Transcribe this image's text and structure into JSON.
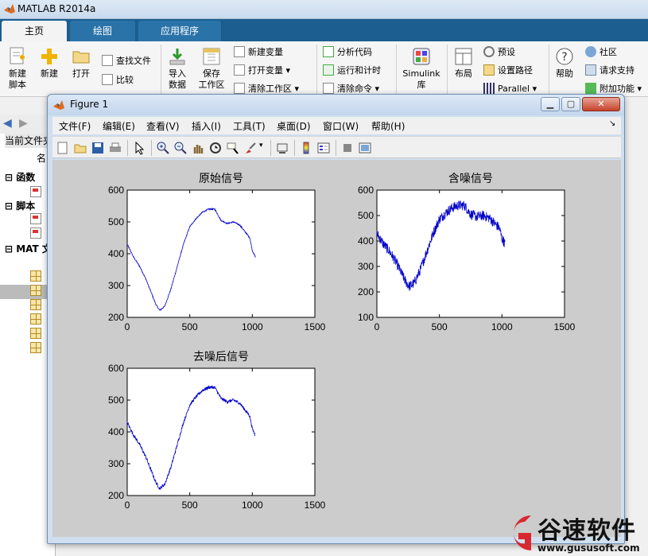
{
  "app": {
    "title": "MATLAB R2014a"
  },
  "ribbon": {
    "tabs": [
      "主页",
      "绘图",
      "应用程序"
    ],
    "active_tab": 0,
    "buttons": {
      "new_script": [
        "新建",
        "脚本"
      ],
      "new": "新建",
      "open": "打开",
      "find_files": "查找文件",
      "compare": "比较",
      "import": [
        "导入",
        "数据"
      ],
      "save_workspace": [
        "保存",
        "工作区"
      ],
      "new_variable": "新建变量",
      "open_variable": "打开变量",
      "clear_workspace": "清除工作区",
      "analyze_code": "分析代码",
      "run_and_time": "运行和计时",
      "clear_commands": "清除命令",
      "simulink": [
        "Simulink",
        "库"
      ],
      "layout": "布局",
      "preferences": "预设",
      "set_path": "设置路径",
      "parallel": "Parallel",
      "help": "帮助",
      "community": "社区",
      "request_support": "请求支持",
      "addons": "附加功能"
    }
  },
  "left_panel": {
    "current_folder": "当前文件夹",
    "name_col": "名",
    "sections": [
      "函数",
      "脚本",
      "MAT 文"
    ]
  },
  "figure": {
    "title": "Figure 1",
    "menus": [
      "文件(F)",
      "编辑(E)",
      "查看(V)",
      "插入(I)",
      "工具(T)",
      "桌面(D)",
      "窗口(W)",
      "帮助(H)"
    ],
    "toolbar_icons": [
      "new-figure-icon",
      "open-file-icon",
      "save-icon",
      "print-icon",
      "pointer-icon",
      "zoom-in-icon",
      "zoom-out-icon",
      "pan-icon",
      "rotate-icon",
      "data-cursor-icon",
      "brush-icon",
      "link-icon",
      "colorbar-icon",
      "legend-icon",
      "hide-plot-tools-icon",
      "show-plot-tools-icon"
    ],
    "line_color": "#0000c8",
    "background": "#cccccc"
  },
  "chart_data": [
    {
      "type": "line",
      "title": "原始信号",
      "xlim": [
        0,
        1500
      ],
      "ylim": [
        200,
        600
      ],
      "xticks": [
        "0",
        "500",
        "1000",
        "1500"
      ],
      "yticks": [
        "200",
        "300",
        "400",
        "500",
        "600"
      ],
      "x": [
        0,
        50,
        100,
        150,
        200,
        230,
        260,
        300,
        350,
        400,
        450,
        500,
        550,
        600,
        650,
        700,
        750,
        800,
        850,
        900,
        950,
        980,
        1000,
        1024
      ],
      "y": [
        430,
        390,
        360,
        320,
        270,
        240,
        222,
        235,
        290,
        360,
        430,
        485,
        510,
        530,
        540,
        540,
        505,
        495,
        500,
        490,
        465,
        450,
        410,
        390
      ]
    },
    {
      "type": "line",
      "title": "含噪信号",
      "xlim": [
        0,
        1500
      ],
      "ylim": [
        100,
        600
      ],
      "xticks": [
        "0",
        "500",
        "1000",
        "1500"
      ],
      "yticks": [
        "100",
        "200",
        "300",
        "400",
        "500",
        "600"
      ],
      "x": [
        0,
        50,
        100,
        150,
        200,
        230,
        260,
        300,
        350,
        400,
        450,
        500,
        550,
        600,
        650,
        700,
        750,
        800,
        850,
        900,
        950,
        980,
        1000,
        1024
      ],
      "y": [
        430,
        390,
        360,
        320,
        270,
        240,
        222,
        235,
        290,
        360,
        430,
        485,
        510,
        530,
        540,
        540,
        505,
        495,
        500,
        490,
        465,
        450,
        410,
        390
      ],
      "noise_amplitude": 40
    },
    {
      "type": "line",
      "title": "去噪后信号",
      "xlim": [
        0,
        1500
      ],
      "ylim": [
        200,
        600
      ],
      "xticks": [
        "0",
        "500",
        "1000",
        "1500"
      ],
      "yticks": [
        "200",
        "300",
        "400",
        "500",
        "600"
      ],
      "x": [
        0,
        50,
        100,
        150,
        200,
        230,
        260,
        300,
        350,
        400,
        450,
        500,
        550,
        600,
        650,
        700,
        750,
        800,
        850,
        900,
        950,
        980,
        1000,
        1024
      ],
      "y": [
        430,
        390,
        360,
        320,
        270,
        240,
        222,
        235,
        290,
        360,
        430,
        485,
        510,
        530,
        540,
        540,
        505,
        495,
        500,
        490,
        465,
        450,
        410,
        390
      ],
      "noise_amplitude": 10
    }
  ],
  "watermark": {
    "brand": "谷速软件",
    "url": "www.gususoft.com"
  }
}
